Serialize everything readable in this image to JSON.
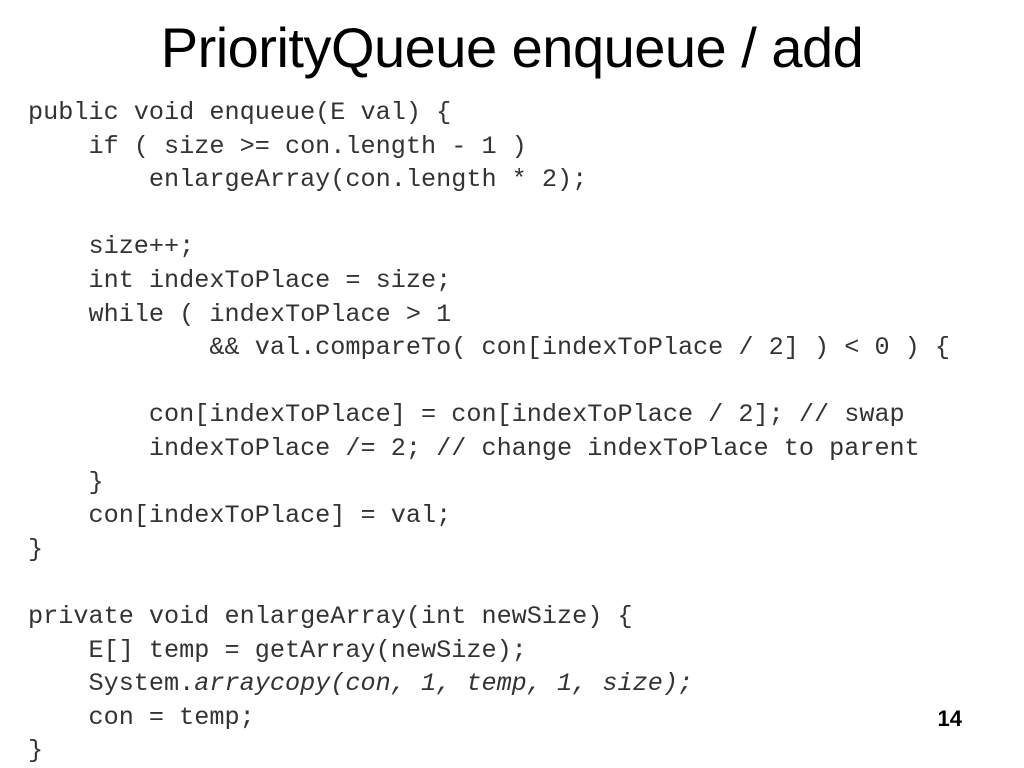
{
  "slide": {
    "title": "PriorityQueue enqueue / add",
    "page_number": "14"
  },
  "code": {
    "lines": [
      {
        "segments": [
          {
            "text": "public void enqueue(E val) {",
            "italic": false
          }
        ]
      },
      {
        "segments": [
          {
            "text": "    if ( size >= con.length - 1 )",
            "italic": false
          }
        ]
      },
      {
        "segments": [
          {
            "text": "        enlargeArray(con.length * 2);",
            "italic": false
          }
        ]
      },
      {
        "segments": [
          {
            "text": "",
            "italic": false
          }
        ]
      },
      {
        "segments": [
          {
            "text": "    size++;",
            "italic": false
          }
        ]
      },
      {
        "segments": [
          {
            "text": "    int indexToPlace = size;",
            "italic": false
          }
        ]
      },
      {
        "segments": [
          {
            "text": "    while ( indexToPlace > 1",
            "italic": false
          }
        ]
      },
      {
        "segments": [
          {
            "text": "            && val.compareTo( con[indexToPlace / 2] ) < 0 ) {",
            "italic": false
          }
        ]
      },
      {
        "segments": [
          {
            "text": "",
            "italic": false
          }
        ]
      },
      {
        "segments": [
          {
            "text": "        con[indexToPlace] = con[indexToPlace / 2]; // swap",
            "italic": false
          }
        ]
      },
      {
        "segments": [
          {
            "text": "        indexToPlace /= 2; // change indexToPlace to parent",
            "italic": false
          }
        ]
      },
      {
        "segments": [
          {
            "text": "    }",
            "italic": false
          }
        ]
      },
      {
        "segments": [
          {
            "text": "    con[indexToPlace] = val;",
            "italic": false
          }
        ]
      },
      {
        "segments": [
          {
            "text": "}",
            "italic": false
          }
        ]
      },
      {
        "segments": [
          {
            "text": "",
            "italic": false
          }
        ]
      },
      {
        "segments": [
          {
            "text": "private void enlargeArray(int newSize) {",
            "italic": false
          }
        ]
      },
      {
        "segments": [
          {
            "text": "    E[] temp = getArray(newSize);",
            "italic": false
          }
        ]
      },
      {
        "segments": [
          {
            "text": "    System.",
            "italic": false
          },
          {
            "text": "arraycopy(con, 1, temp, 1, size);",
            "italic": true
          }
        ]
      },
      {
        "segments": [
          {
            "text": "    con = temp;",
            "italic": false
          }
        ]
      },
      {
        "segments": [
          {
            "text": "}",
            "italic": false
          }
        ]
      }
    ]
  }
}
